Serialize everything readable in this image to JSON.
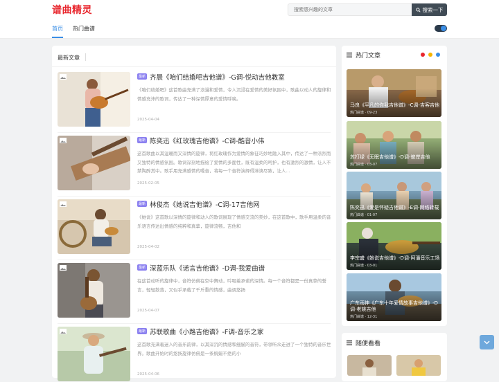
{
  "header": {
    "logo": "谱曲精灵",
    "search_placeholder": "搜索感兴趣的文章",
    "search_button": "搜索一下"
  },
  "nav": {
    "items": [
      {
        "label": "首页",
        "active": true
      },
      {
        "label": "热门曲谱",
        "active": false
      }
    ]
  },
  "main": {
    "section_title": "最新文章",
    "badge": "最新",
    "articles": [
      {
        "title": "齐晨《咱们结婚吧吉他谱》-G调-悦动吉他教室",
        "excerpt": "《咱们结婚吧》这首歌曲充满了浪漫和爱情，令人沉浸在爱情的美好氛围中，歌曲以动人的旋律和情感充沛的歌词，传达了一种深情厚意的爱情呼唤。",
        "date": "2025-04-04"
      },
      {
        "title": "陈奕迅《红玫瑰吉他谱》-C调-酷音小伟",
        "excerpt": "这首歌曲以其温暖而又深情的旋律，将红玫瑰作为爱情的象征巧妙地融入其中，传达了一种浓烈而又独特的情感氛围。歌词深刻地描绘了爱情的多面性，既有温柔的呵护，也有激烈的激情，让人不禁陶醉其中。歌手用充满感情的嗓音，将每一个音符演绎得淋漓尽致，让人...",
        "date": "2025-02-05"
      },
      {
        "title": "林俊杰《她说吉他谱》-C调-17吉他网",
        "excerpt": "《她说》这首歌以深情的旋律和动人的歌词展现了情感交流的美妙，在这首歌中，歌手用温柔的音乐语言传达出情感的纯粹和真挚，旋律流畅，吉他和",
        "date": "2025-04-02"
      },
      {
        "title": "深蓝乐队《诺言吉他谱》-D调-我爱曲谱",
        "excerpt": "在这首动听的旋律中，音符仿佛在空中舞动，吟唱着承诺的深情。每一个音符都是一份真挚的誓言，轻轻散落，又似乎承载了千斤重的情感，曲调悠扬",
        "date": "2025-04-07"
      },
      {
        "title": "苏联歌曲《小路吉他谱》-F调-音乐之家",
        "excerpt": "这首歌充满着迷人的音乐韵律，以其深沉的情感和细腻的音符，带领听众走进了一个独特的音乐世界。歌曲开始时的悠扬旋律仿佛是一条蜿蜒不绝的小",
        "date": "2025-04-06"
      }
    ]
  },
  "sidebar": {
    "hot_title": "热门文章",
    "dot_colors": [
      "#e8262d",
      "#f5b400",
      "#3a8ee6"
    ],
    "hot_items": [
      {
        "title": "马良《平凡的你我吉他谱》-C调-吉客吉他",
        "meta": "热门曲谱 · 09-23"
      },
      {
        "title": "苏打绿《无眠吉他谱》-D调-彼岸吉他",
        "meta": "热门曲谱 · 03-07"
      },
      {
        "title": "陈奕迅《爱是怀疑吉他谱》-E调-网络转载",
        "meta": "热门曲谱 · 01-07"
      },
      {
        "title": "李宗盛《她说吉他谱》-D调-阿潘音乐工场",
        "meta": "热门曲谱 · 03-01"
      },
      {
        "title": "广东雨神《广东十年爱情故事吉他谱》-D调-老姚吉他",
        "meta": "热门曲谱 · 12-31"
      }
    ],
    "random_title": "随便看看"
  },
  "colors": {
    "brand": "#e8262d",
    "accent": "#3a8ee6",
    "badge": "#8a7ff0",
    "search_button": "#404b55"
  }
}
